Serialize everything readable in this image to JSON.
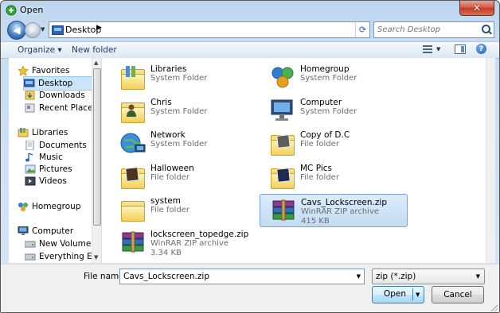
{
  "window": {
    "title": "Open"
  },
  "nav": {
    "address_path": "Desktop",
    "search_placeholder": "Search Desktop"
  },
  "toolbar": {
    "organize_label": "Organize ▾",
    "new_folder_label": "New folder"
  },
  "sidebar": {
    "items": [
      {
        "label": "Favorites",
        "icon": "star-icon",
        "level": 0
      },
      {
        "label": "Desktop",
        "icon": "desktop-icon",
        "level": 1,
        "selected": true
      },
      {
        "label": "Downloads",
        "icon": "downloads-icon",
        "level": 1
      },
      {
        "label": "Recent Places",
        "icon": "recent-places-icon",
        "level": 1
      },
      {
        "label": "Libraries",
        "icon": "libraries-icon",
        "level": 0
      },
      {
        "label": "Documents",
        "icon": "documents-icon",
        "level": 1
      },
      {
        "label": "Music",
        "icon": "music-icon",
        "level": 1
      },
      {
        "label": "Pictures",
        "icon": "pictures-icon",
        "level": 1
      },
      {
        "label": "Videos",
        "icon": "videos-icon",
        "level": 1
      },
      {
        "label": "Homegroup",
        "icon": "homegroup-icon",
        "level": 0
      },
      {
        "label": "Computer",
        "icon": "computer-icon",
        "level": 0
      },
      {
        "label": "New Volume (C:)",
        "icon": "drive-icon",
        "level": 1
      },
      {
        "label": "Everything Else (I",
        "icon": "drive-icon",
        "level": 1
      }
    ]
  },
  "files": [
    {
      "name": "Libraries",
      "type": "System Folder",
      "icon": "libraries-icon"
    },
    {
      "name": "Homegroup",
      "type": "System Folder",
      "icon": "homegroup-icon"
    },
    {
      "name": "Chris",
      "type": "System Folder",
      "icon": "user-folder-icon"
    },
    {
      "name": "Computer",
      "type": "System Folder",
      "icon": "computer-icon"
    },
    {
      "name": "Network",
      "type": "System Folder",
      "icon": "network-icon"
    },
    {
      "name": "Copy of D.C",
      "type": "File folder",
      "icon": "folder-icon"
    },
    {
      "name": "Halloween",
      "type": "File folder",
      "icon": "folder-icon"
    },
    {
      "name": "MC Pics",
      "type": "File folder",
      "icon": "folder-icon"
    },
    {
      "name": "system",
      "type": "File folder",
      "icon": "folder-icon"
    },
    {
      "name": "Cavs_Lockscreen.zip",
      "type": "WinRAR ZIP archive",
      "size": "415 KB",
      "icon": "winrar-archive-icon",
      "selected": true
    },
    {
      "name": "lockscreen_topedge.zip",
      "type": "WinRAR ZIP archive",
      "size": "3.34 KB",
      "icon": "winrar-archive-icon"
    }
  ],
  "bottom": {
    "filename_label": "File name:",
    "filename_value": "Cavs_Lockscreen.zip",
    "filter_value": "zip (*.zip)",
    "open_label": "Open",
    "cancel_label": "Cancel"
  },
  "colors": {
    "selection_bg": "#cce4f7",
    "selection_border": "#7da2ce",
    "close_button": "#c23a1f"
  }
}
